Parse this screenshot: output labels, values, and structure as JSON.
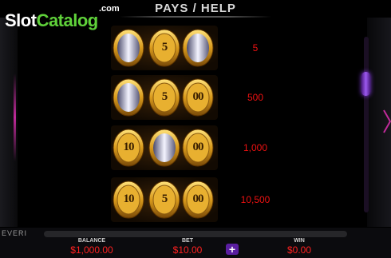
{
  "logo": {
    "brand_part1": "Slot",
    "brand_part2": "Catalog",
    "dotcom": ".com"
  },
  "header": {
    "title": "PAYS / HELP"
  },
  "paytable": [
    {
      "symbols": [
        "",
        "5",
        ""
      ],
      "payout": "5"
    },
    {
      "symbols": [
        "",
        "5",
        "00"
      ],
      "payout": "500"
    },
    {
      "symbols": [
        "10",
        "",
        "00"
      ],
      "payout": "1,000"
    },
    {
      "symbols": [
        "10",
        "5",
        "00"
      ],
      "payout": "10,500"
    }
  ],
  "footer": {
    "provider": "EVERI",
    "balance_label": "BALANCE",
    "balance_value": "$1,000.00",
    "bet_label": "BET",
    "bet_value": "$10.00",
    "win_label": "WIN",
    "win_value": "$0.00",
    "plus": "+"
  },
  "colors": {
    "payout": "#ee1111",
    "gold": "#d99a1c",
    "accent": "#8a3ee8"
  },
  "icons": {
    "arrow_right": "chevron-right-icon",
    "blank_symbol": "blank-mirror-icon"
  }
}
